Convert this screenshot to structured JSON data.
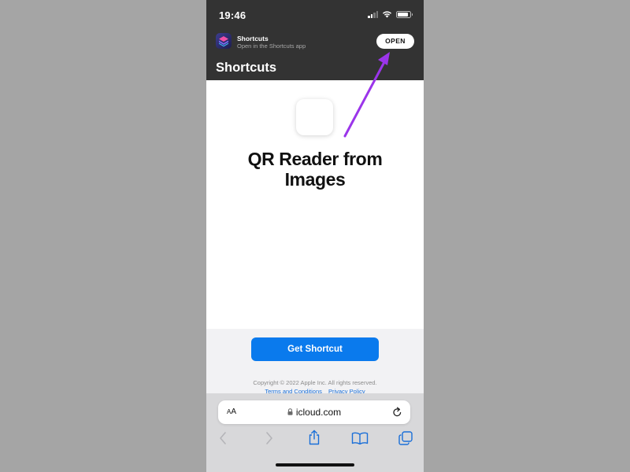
{
  "status_bar": {
    "time": "19:46"
  },
  "app_banner": {
    "app_name": "Shortcuts",
    "subtitle": "Open in the Shortcuts app",
    "open_label": "OPEN"
  },
  "header": {
    "title": "Shortcuts"
  },
  "shortcut": {
    "title_line1": "QR Reader from",
    "title_line2": "Images",
    "get_button_label": "Get Shortcut"
  },
  "footer": {
    "copyright": "Copyright © 2022 Apple Inc. All rights reserved.",
    "terms_label": "Terms and Conditions",
    "privacy_label": "Privacy Policy"
  },
  "safari": {
    "aa_label_small": "A",
    "aa_label_big": "A",
    "url": "icloud.com"
  },
  "colors": {
    "background": "#a5a5a5",
    "header_dark": "#333333",
    "accent_blue": "#0a7aed",
    "annotation_arrow": "#9b35ea"
  }
}
